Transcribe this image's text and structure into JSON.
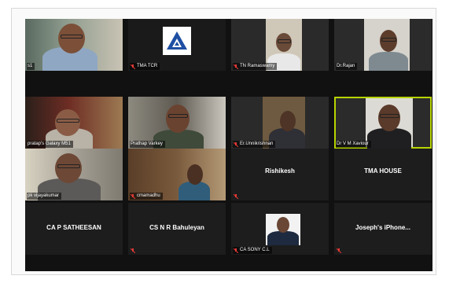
{
  "tiles": [
    {
      "id": "t1",
      "label": "s1",
      "muted": false
    },
    {
      "id": "t2",
      "label": "TMA TCR",
      "muted": true
    },
    {
      "id": "t3",
      "label": "TN Ramaswamy",
      "muted": true
    },
    {
      "id": "t4",
      "label": "Dr.Rajan",
      "muted": false
    },
    {
      "id": "t5",
      "label": "pratap's Galaxy M51",
      "muted": false
    },
    {
      "id": "t6",
      "label": "Prathap Varkey",
      "muted": false
    },
    {
      "id": "t7",
      "label": "Er.Unnikrishnan",
      "muted": true
    },
    {
      "id": "t8",
      "label": "Dr V M Xaviour",
      "muted": false
    },
    {
      "id": "t9",
      "label": "pk vijayakumar",
      "muted": false
    },
    {
      "id": "t10",
      "label": "cmamadhu",
      "muted": true
    },
    {
      "id": "t11",
      "name": "Rishikesh",
      "muted": true
    },
    {
      "id": "t12",
      "name": "TMA HOUSE",
      "muted": false
    },
    {
      "id": "t13",
      "name": "CA P SATHEESAN",
      "muted": false
    },
    {
      "id": "t14",
      "name": "CS N R Bahuleyan",
      "muted": true
    },
    {
      "id": "t15",
      "label": "CA SONY C.L",
      "muted": true
    },
    {
      "id": "t16",
      "name": "Joseph's iPhone...",
      "muted": true
    }
  ],
  "colors": {
    "active_speaker": "#b7d400",
    "muted_icon": "#e53935",
    "logo_blue": "#1e4fa3"
  }
}
